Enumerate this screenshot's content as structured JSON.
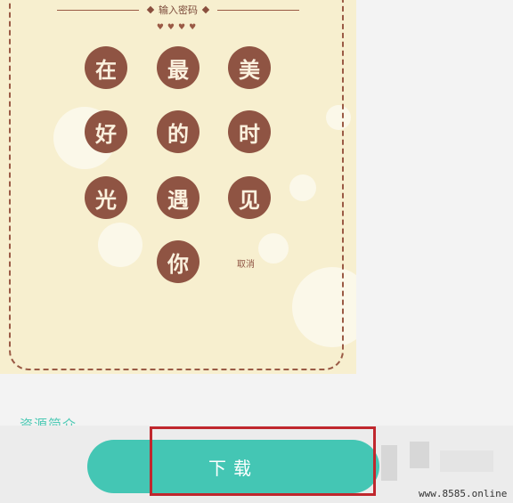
{
  "lock": {
    "title": "输入密码",
    "hearts": "♥♥♥♥",
    "keys": [
      "在",
      "最",
      "美",
      "好",
      "的",
      "时",
      "光",
      "遇",
      "见",
      "你"
    ],
    "cancel_label": "取消"
  },
  "bottom": {
    "section_label": "资源简介",
    "download_label": "下载"
  },
  "watermark": "www.8585.online",
  "colors": {
    "panel_bg": "#f7efcf",
    "key_bg": "#8f5443",
    "button_bg": "#44c6b4",
    "highlight": "#c0272d"
  }
}
